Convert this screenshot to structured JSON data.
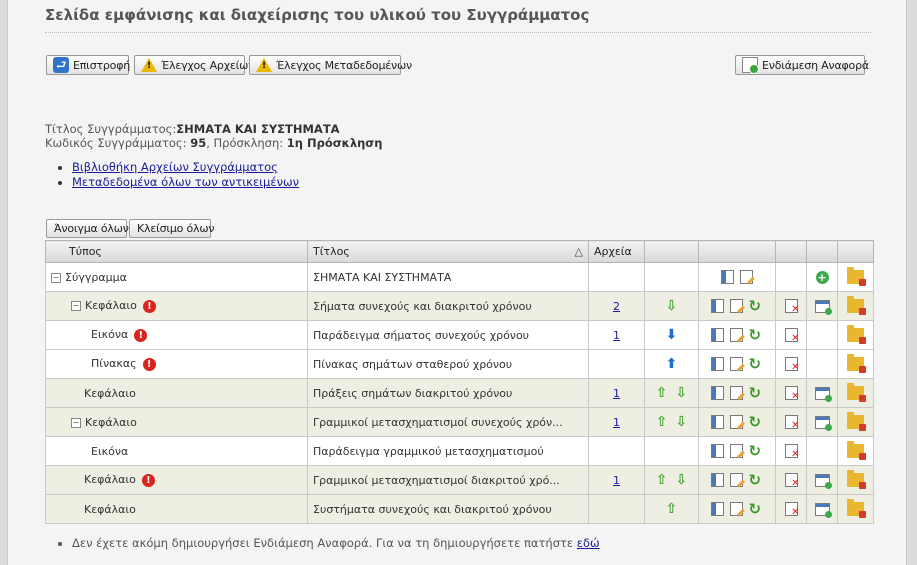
{
  "page": {
    "title": "Σελίδα εμφάνισης και διαχείρισης του υλικού του Συγγράμματος"
  },
  "toolbar": {
    "back_label": "Επιστροφή",
    "files_check_label": "Έλεγχος Αρχείων",
    "metadata_check_label": "Έλεγχος Μεταδεδομένων",
    "interim_report_label": "Ενδιάμεση Αναφορά"
  },
  "info": {
    "title_label": "Τίτλος Συγγράμματος:",
    "title_value": "ΣΗΜΑΤΑ ΚΑΙ ΣΥΣΤΗΜΑΤΑ",
    "code_label": "Κωδικός Συγγράμματος:",
    "code_value": "95",
    "call_label": ", Πρόσκληση:",
    "call_value": "1η Πρόσκληση"
  },
  "links": [
    "Βιβλιοθήκη Αρχείων Συγγράμματος",
    "Μεταδεδομένα όλων των αντικειμένων"
  ],
  "tree_controls": {
    "open_all": "Άνοιγμα όλων",
    "close_all": "Κλείσιμο όλων"
  },
  "table": {
    "headers": {
      "type": "Τύπος",
      "title": "Τίτλος",
      "files": "Αρχεία"
    },
    "rows": [
      {
        "type": "Σύγγραμμα",
        "title": "ΣΗΜΑΤΑ ΚΑΙ ΣΥΣΤΗΜΑΤΑ",
        "files": ""
      },
      {
        "type": "Κεφάλαιο",
        "title": "Σήματα συνεχούς και διακριτού χρόνου",
        "files": "2"
      },
      {
        "type": "Εικόνα",
        "title": "Παράδειγμα σήματος συνεχούς χρόνου",
        "files": "1"
      },
      {
        "type": "Πίνακας",
        "title": "Πίνακας σημάτων σταθερού χρόνου",
        "files": ""
      },
      {
        "type": "Κεφάλαιο",
        "title": "Πράξεις σημάτων διακριτού χρόνου",
        "files": "1"
      },
      {
        "type": "Κεφάλαιο",
        "title": "Γραμμικοί μετασχηματισμοί συνεχούς χρόν...",
        "files": "1"
      },
      {
        "type": "Εικόνα",
        "title": "Παράδειγμα γραμμικού μετασχηματισμού",
        "files": ""
      },
      {
        "type": "Κεφάλαιο",
        "title": "Γραμμικοί μετασχηματισμοί διακριτού χρό...",
        "files": "1"
      },
      {
        "type": "Κεφάλαιο",
        "title": "Συστήματα συνεχούς και διακριτού χρόνου",
        "files": ""
      }
    ]
  },
  "footer": {
    "note": "Δεν έχετε ακόμη δημιουργήσει Ενδιάμεση Αναφορά. Για να τη δημιουργήσετε πατήστε ",
    "link": "εδώ"
  }
}
